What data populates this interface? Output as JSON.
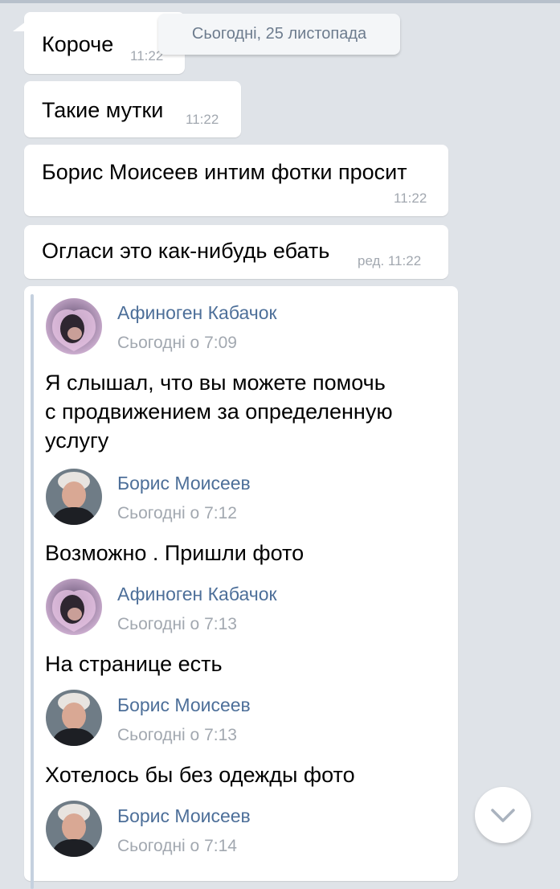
{
  "date_divider": "Сьогодні, 25 листопада",
  "messages": [
    {
      "text": "Короче",
      "time": "11:22"
    },
    {
      "text": "Такие мутки",
      "time": "11:22"
    },
    {
      "text": "Борис Моисеев интим фотки просит",
      "time": "11:22"
    },
    {
      "text": "Огласи это как-нибудь ебать",
      "time": "ред. 11:22"
    }
  ],
  "forwarded": [
    {
      "author": "Афиноген Кабачок",
      "time": "Сьогодні о 7:09",
      "avatar": "girl-avatar",
      "text_lines": [
        "Я слышал, что вы можете помочь",
        "с продвижением за определенную",
        "услугу"
      ]
    },
    {
      "author": "Борис Моисеев",
      "time": "Сьогодні о 7:12",
      "avatar": "man-avatar",
      "text_lines": [
        "Возможно . Пришли фото"
      ]
    },
    {
      "author": "Афиноген Кабачок",
      "time": "Сьогодні о 7:13",
      "avatar": "girl-avatar",
      "text_lines": [
        "На странице есть"
      ]
    },
    {
      "author": "Борис Моисеев",
      "time": "Сьогодні о 7:13",
      "avatar": "man-avatar",
      "text_lines": [
        "Хотелось бы без одежды фото"
      ]
    },
    {
      "author": "Борис Моисеев",
      "time": "Сьогодні о 7:14",
      "avatar": "man-avatar",
      "text_lines": []
    }
  ],
  "scroll_button_icon": "chevron-down-icon",
  "colors": {
    "background": "#dfe3e8",
    "author": "#4d6f99",
    "meta": "#a2a8b0",
    "quote_bar": "#c5d1df"
  }
}
